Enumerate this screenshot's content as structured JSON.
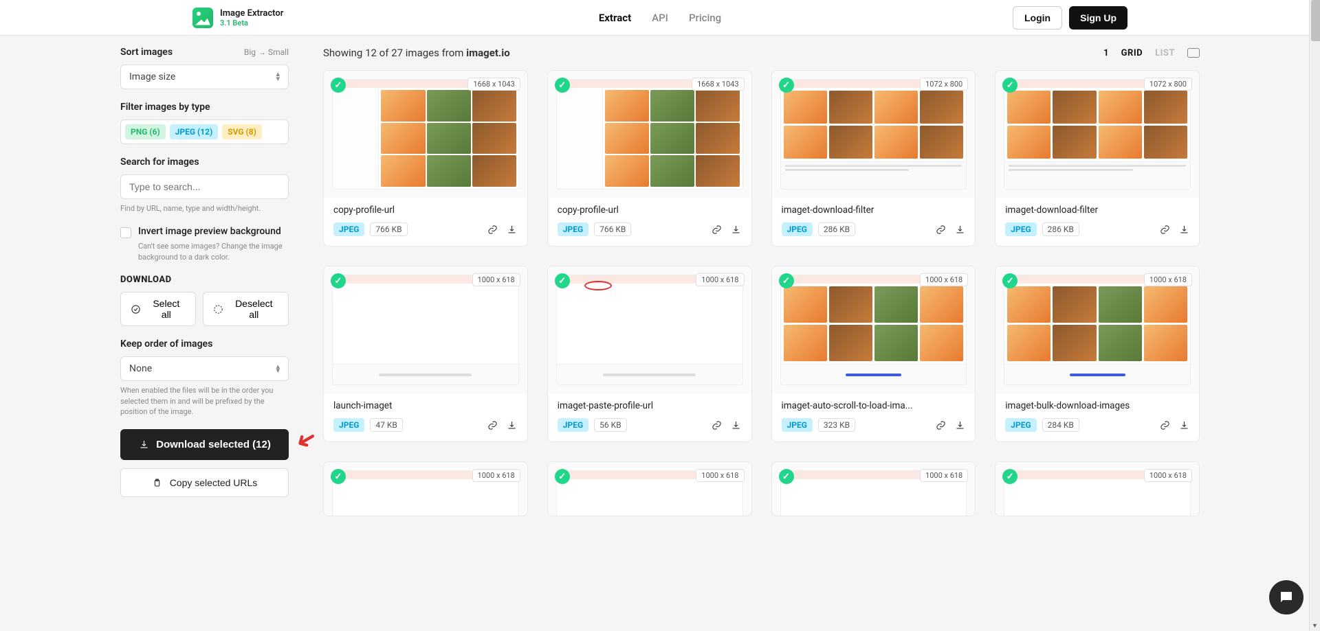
{
  "header": {
    "app_title": "Image Extractor",
    "version": "3.1 Beta",
    "nav": {
      "extract": "Extract",
      "api": "API",
      "pricing": "Pricing"
    },
    "login": "Login",
    "signup": "Sign Up"
  },
  "sidebar": {
    "sort_label": "Sort images",
    "sort_order": "Big → Small",
    "sort_value": "Image size",
    "filter_label": "Filter images by type",
    "chips": {
      "png": "PNG (6)",
      "jpeg": "JPEG (12)",
      "svg": "SVG (8)"
    },
    "search_label": "Search for images",
    "search_placeholder": "Type to search...",
    "search_hint": "Find by URL, name, type and width/height.",
    "invert_label": "Invert image preview background",
    "invert_hint": "Can't see some images? Change the image background to a dark color.",
    "download_heading": "DOWNLOAD",
    "select_all": "Select all",
    "deselect_all": "Deselect all",
    "keep_order_label": "Keep order of images",
    "keep_order_value": "None",
    "keep_order_hint": "When enabled the files will be in the order you selected them in and will be prefixed by the position of the image.",
    "download_selected": "Download selected (12)",
    "copy_urls": "Copy selected URLs"
  },
  "content": {
    "showing_prefix": "Showing ",
    "showing_count": "12",
    "showing_of": " of ",
    "showing_total": "27",
    "showing_suffix": " images from ",
    "domain": "imaget.io",
    "page": "1",
    "view_grid": "GRID",
    "view_list": "LIST"
  },
  "cards": [
    {
      "dim": "1668 x 1043",
      "title": "copy-profile-url",
      "type": "JPEG",
      "size": "766 KB",
      "thumbKind": "grid-side"
    },
    {
      "dim": "1668 x 1043",
      "title": "copy-profile-url",
      "type": "JPEG",
      "size": "766 KB",
      "thumbKind": "grid-side"
    },
    {
      "dim": "1072 x 800",
      "title": "imaget-download-filter",
      "type": "JPEG",
      "size": "286 KB",
      "thumbKind": "grid-foot"
    },
    {
      "dim": "1072 x 800",
      "title": "imaget-download-filter",
      "type": "JPEG",
      "size": "286 KB",
      "thumbKind": "grid-foot"
    },
    {
      "dim": "1000 x 618",
      "title": "launch-imaget",
      "type": "JPEG",
      "size": "47 KB",
      "thumbKind": "blank"
    },
    {
      "dim": "1000 x 618",
      "title": "imaget-paste-profile-url",
      "type": "JPEG",
      "size": "56 KB",
      "thumbKind": "blank-circle"
    },
    {
      "dim": "1000 x 618",
      "title": "imaget-auto-scroll-to-load-ima...",
      "type": "JPEG",
      "size": "323 KB",
      "thumbKind": "grid-mixed"
    },
    {
      "dim": "1000 x 618",
      "title": "imaget-bulk-download-images",
      "type": "JPEG",
      "size": "284 KB",
      "thumbKind": "grid-mixed"
    },
    {
      "dim": "1000 x 618",
      "title": "",
      "type": "",
      "size": "",
      "thumbKind": "partial"
    },
    {
      "dim": "1000 x 618",
      "title": "",
      "type": "",
      "size": "",
      "thumbKind": "partial"
    },
    {
      "dim": "1000 x 618",
      "title": "",
      "type": "",
      "size": "",
      "thumbKind": "partial"
    },
    {
      "dim": "1000 x 618",
      "title": "",
      "type": "",
      "size": "",
      "thumbKind": "partial"
    }
  ]
}
